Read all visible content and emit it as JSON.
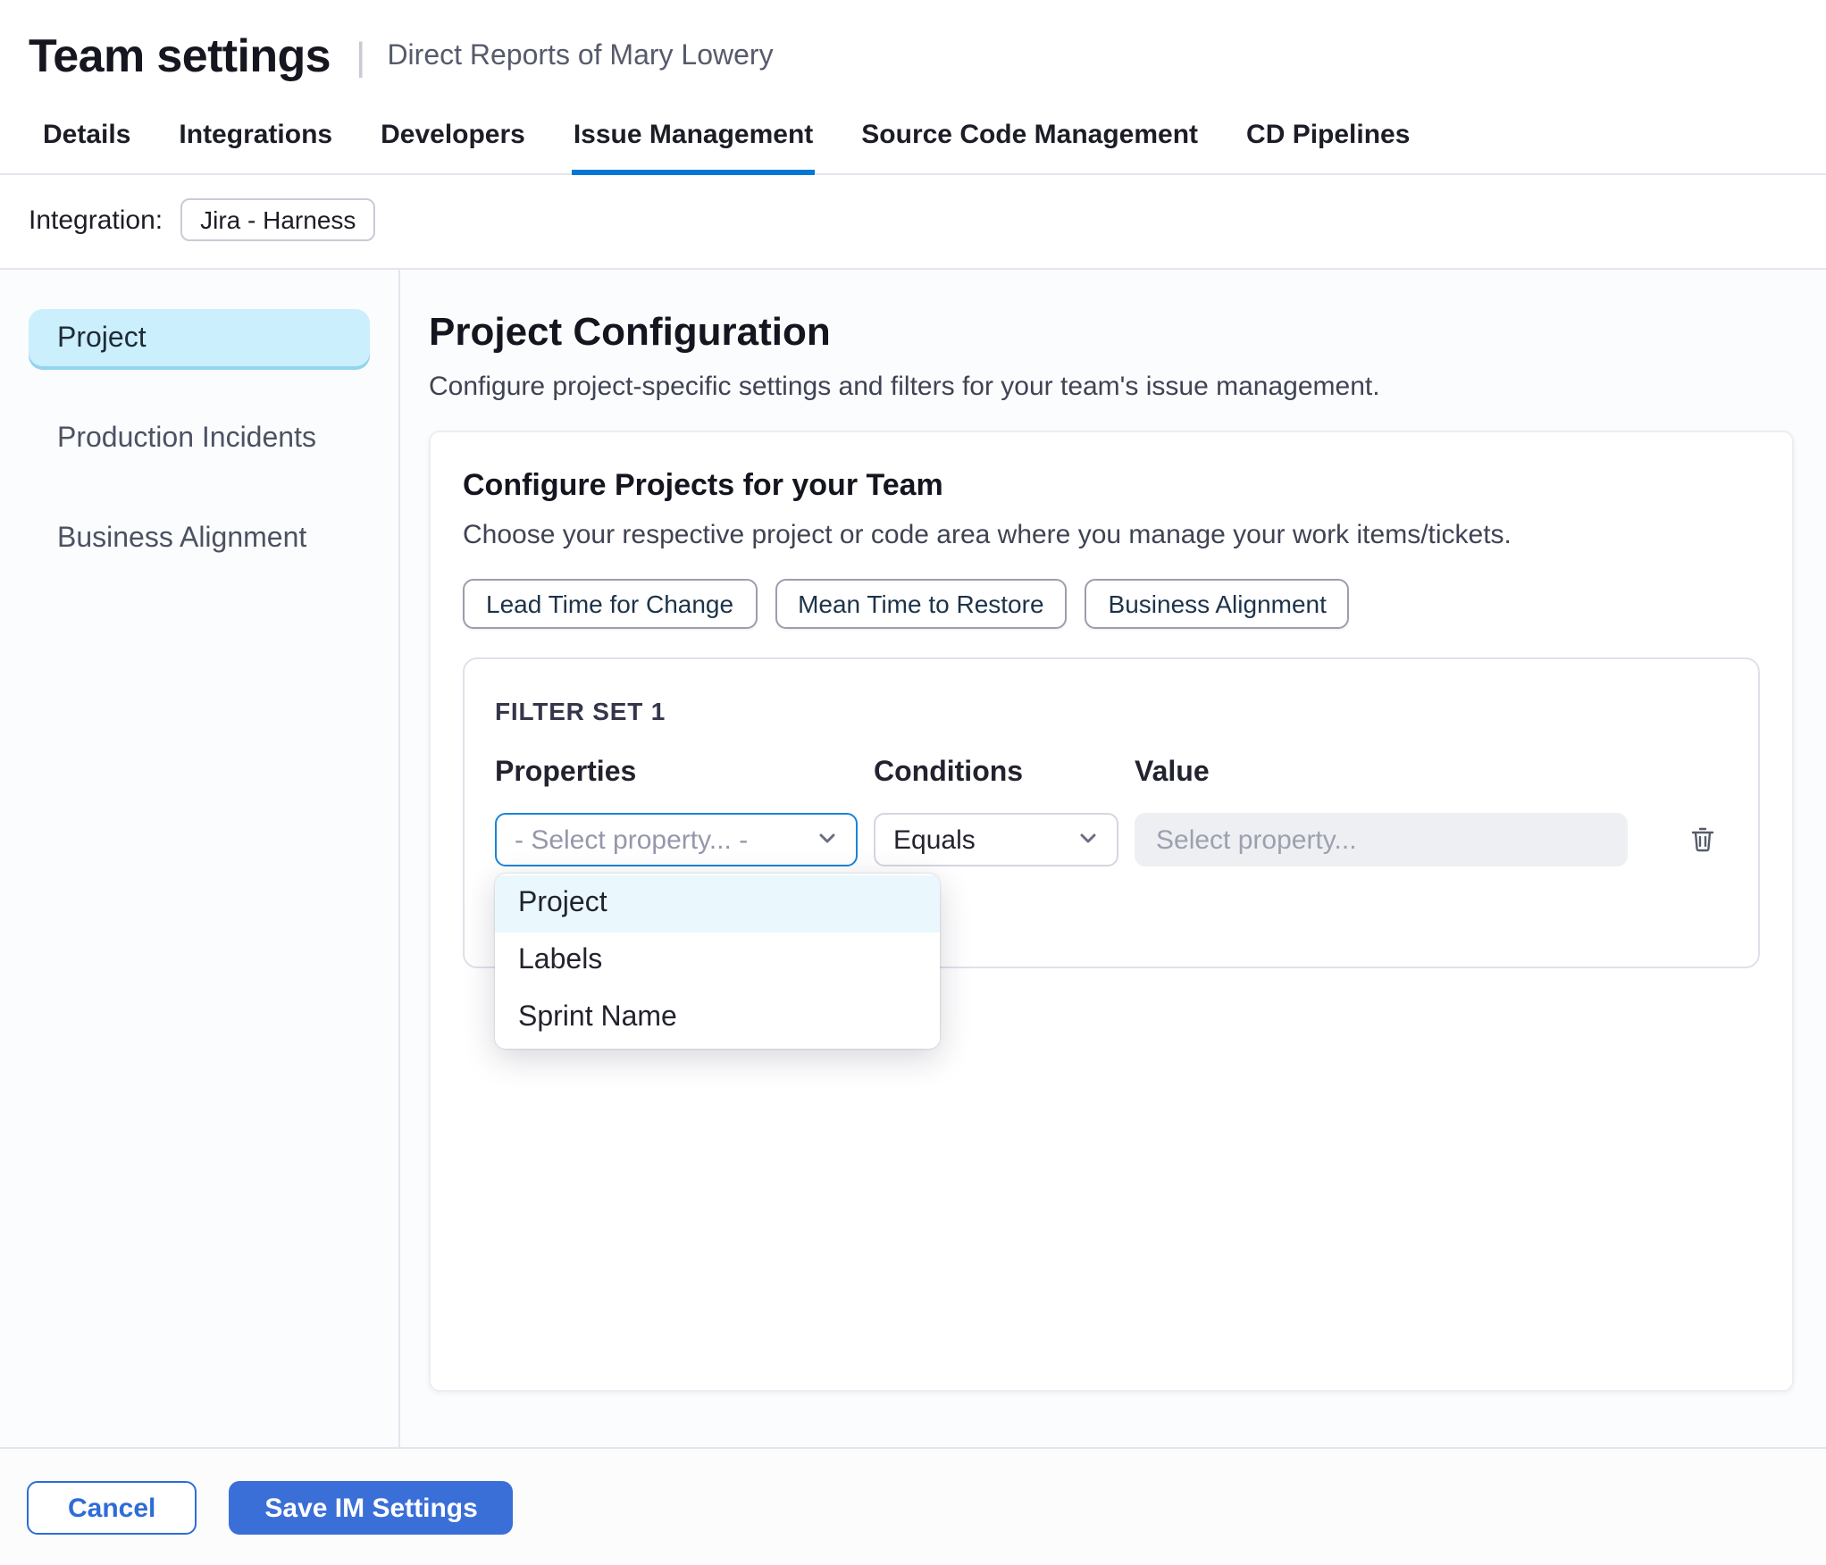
{
  "header": {
    "title": "Team settings",
    "divider": "|",
    "subtitle": "Direct Reports of Mary Lowery"
  },
  "tabs": [
    {
      "label": "Details",
      "active": false
    },
    {
      "label": "Integrations",
      "active": false
    },
    {
      "label": "Developers",
      "active": false
    },
    {
      "label": "Issue Management",
      "active": true
    },
    {
      "label": "Source Code Management",
      "active": false
    },
    {
      "label": "CD Pipelines",
      "active": false
    }
  ],
  "integration": {
    "label": "Integration:",
    "badge": "Jira - Harness"
  },
  "sidebar": {
    "items": [
      {
        "label": "Project",
        "active": true
      },
      {
        "label": "Production Incidents",
        "active": false
      },
      {
        "label": "Business Alignment",
        "active": false
      }
    ]
  },
  "main": {
    "title": "Project Configuration",
    "description": "Configure project-specific settings and filters for your team's issue management.",
    "card": {
      "title": "Configure Projects for your Team",
      "description": "Choose your respective project or code area where you manage your work items/tickets.",
      "chips": [
        "Lead Time for Change",
        "Mean Time to Restore",
        "Business Alignment"
      ],
      "filter_set": {
        "title": "FILTER SET 1",
        "columns": [
          "Properties",
          "Conditions",
          "Value"
        ],
        "property_select": {
          "value": "- Select property... -"
        },
        "condition_select": {
          "value": "Equals"
        },
        "value_input": {
          "placeholder": "Select property..."
        },
        "dropdown": {
          "options": [
            {
              "label": "Project",
              "highlighted": true
            },
            {
              "label": "Labels",
              "highlighted": false
            },
            {
              "label": "Sprint Name",
              "highlighted": false
            }
          ]
        }
      }
    }
  },
  "footer": {
    "cancel": "Cancel",
    "save": "Save IM Settings"
  },
  "colors": {
    "accent": "#0278d5",
    "primary_button": "#3b6fd8",
    "cancel_button": "#2e6cd6",
    "sidebar_active_bg": "#cbeffc",
    "dropdown_highlight": "#eaf8fd"
  }
}
